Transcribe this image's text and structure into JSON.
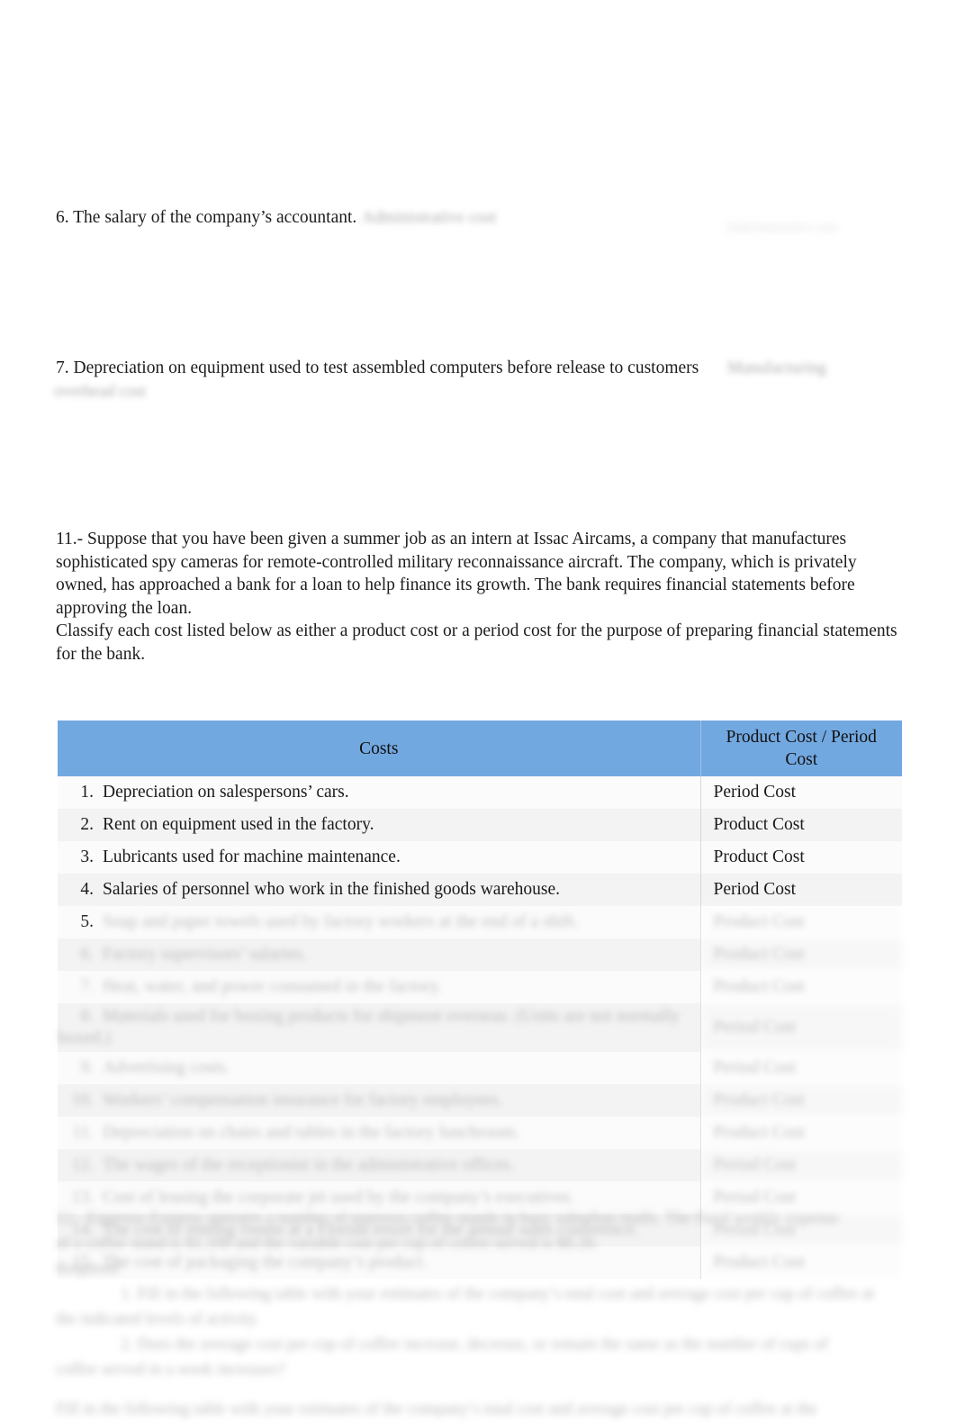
{
  "document": {
    "background_color": "#ffffff",
    "body_font_size_px": 19.5
  },
  "top_items": [
    {
      "number_and_text": "6. The salary of the company’s accountant.",
      "answer": "Administrative cost",
      "margin_note": "Administrative cost"
    },
    {
      "number_and_text": "7. Depreciation on equipment used to test assembled computers before release to customers",
      "answer": "Manufacturing",
      "answer_continued": "overhead cost"
    }
  ],
  "question11": {
    "paragraph1": "11.- Suppose that you have been given a summer job as an intern at Issac Aircams, a company that manufactures sophisticated spy cameras for remote-controlled military reconnaissance aircraft. The company, which is privately owned, has approached a bank for a loan to help finance its growth. The bank requires financial statements before approving the loan.",
    "paragraph2": "Classify each cost listed below as either a product cost or a period cost for the purpose of preparing financial statements for the bank."
  },
  "table": {
    "header_color": "#72a8e0",
    "columns": [
      {
        "label": "Costs"
      },
      {
        "label": "Product Cost / Period Cost"
      }
    ],
    "rows": [
      {
        "num": "1.",
        "cost": "Depreciation on salespersons’ cars.",
        "classification": "Period Cost",
        "blurred": false
      },
      {
        "num": "2.",
        "cost": "Rent on equipment used in the factory.",
        "classification": "Product Cost",
        "blurred": false
      },
      {
        "num": "3.",
        "cost": "Lubricants used for machine maintenance.",
        "classification": "Product Cost",
        "blurred": false
      },
      {
        "num": "4.",
        "cost": "Salaries of personnel who work in the finished goods warehouse.",
        "classification": "Period Cost",
        "blurred": false
      },
      {
        "num": "5.",
        "cost": "Soap and paper towels used by factory workers at the end of a shift.",
        "classification": "Product Cost",
        "blurred": true
      },
      {
        "num": "6.",
        "cost": "Factory supervisors’ salaries.",
        "classification": "Product Cost",
        "blurred": true
      },
      {
        "num": "7.",
        "cost": "Heat, water, and power consumed in the factory.",
        "classification": "Product Cost",
        "blurred": true
      },
      {
        "num": "8.",
        "cost": "Materials used for boxing products for shipment overseas. (Units are not normally boxed.)",
        "classification": "Period Cost",
        "blurred": true
      },
      {
        "num": "9.",
        "cost": "Advertising costs.",
        "classification": "Period Cost",
        "blurred": true
      },
      {
        "num": "10.",
        "cost": "Workers’ compensation insurance for factory employees.",
        "classification": "Product Cost",
        "blurred": true
      },
      {
        "num": "11.",
        "cost": "Depreciation on chairs and tables in the factory lunchroom.",
        "classification": "Product Cost",
        "blurred": true
      },
      {
        "num": "12.",
        "cost": "The wages of the receptionist in the administrative offices.",
        "classification": "Period Cost",
        "blurred": true
      },
      {
        "num": "13.",
        "cost": "Cost of leasing the corporate jet used by the company’s executives.",
        "classification": "Period Cost",
        "blurred": true
      },
      {
        "num": "14.",
        "cost": "The cost of renting rooms at a Florida resort for the annual sales conference.",
        "classification": "Period Cost",
        "blurred": true
      },
      {
        "num": "15.",
        "cost": "The cost of packaging the company’s product.",
        "classification": "Product Cost",
        "blurred": true
      }
    ]
  },
  "bottom_section": {
    "line1": "12.- Espresso Express operates a number of espresso coffee stands in busy suburban malls. The fixed weekly expense",
    "line2": "of a coffee stand is $1,100 and the variable cost per cup of coffee served is $0.26.",
    "required_label": "Required:",
    "item1": "1.    Fill in the following table with your estimates of the company’s total cost and average cost per cup of coffee at",
    "item1_cont": "the indicated levels of activity.",
    "item2": "2.    Does the average cost per cup of coffee increase, decrease, or remain the same as the number of cups of",
    "item2_cont": "coffee served in a week increases?",
    "repeat": "Fill in the following table with your estimates of the company’s total cost and average cost per cup of coffee at the"
  }
}
